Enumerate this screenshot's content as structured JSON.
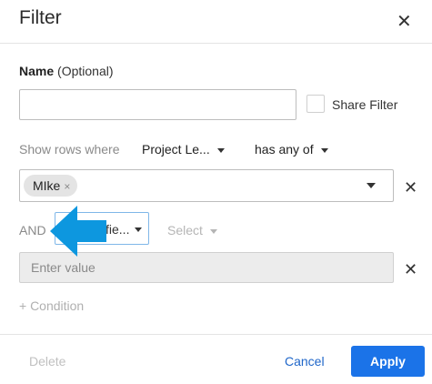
{
  "dialog": {
    "title": "Filter",
    "close_icon": "close-icon"
  },
  "name_section": {
    "label": "Name",
    "optional": "(Optional)",
    "input_value": "",
    "share_label": "Share Filter"
  },
  "condition1": {
    "prefix": "Show rows where",
    "field": "Project Le...",
    "operator": "has any of",
    "chip": "MIke"
  },
  "condition2": {
    "prefix": "AND",
    "field": "fie...",
    "operator": "Select",
    "placeholder": "Enter value"
  },
  "add_condition": "+ Condition",
  "footer": {
    "delete_label": "Delete",
    "cancel_label": "Cancel",
    "apply_label": "Apply"
  },
  "colors": {
    "accent": "#1b73e8",
    "pointer_arrow": "#0d97df"
  }
}
